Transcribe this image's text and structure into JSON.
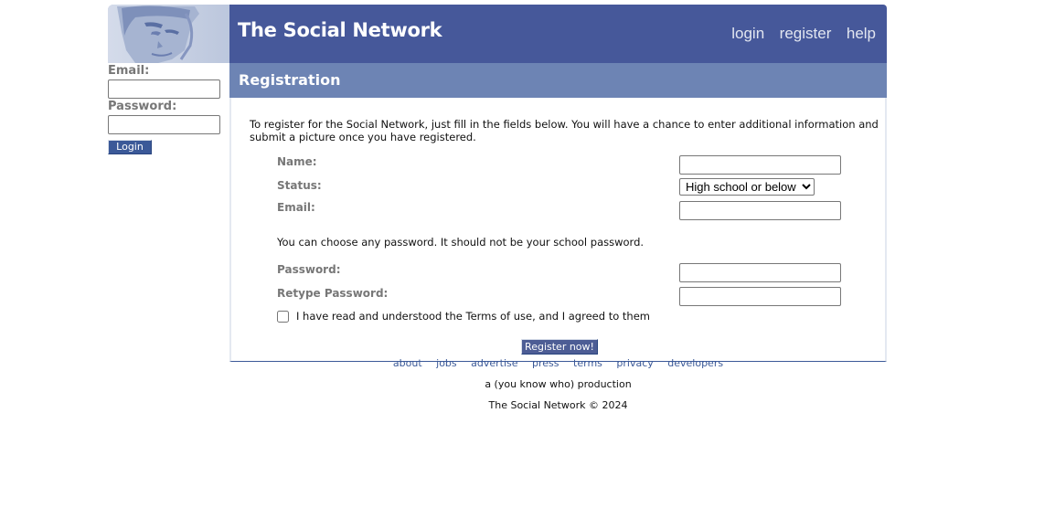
{
  "header": {
    "site_title": "The Social Network",
    "nav": [
      {
        "label": "login"
      },
      {
        "label": "register"
      },
      {
        "label": "help"
      }
    ],
    "brand_color": "#46589a"
  },
  "sidebar": {
    "email_label": "Email:",
    "email_value": "",
    "password_label": "Password:",
    "password_value": "",
    "login_button": "Login"
  },
  "registration": {
    "section_title": "Registration",
    "intro": "To register for the Social Network, just fill in the fields below. You will have a chance to enter additional information and submit a picture once you have registered.",
    "fields": {
      "name_label": "Name:",
      "name_value": "",
      "status_label": "Status:",
      "status_selected": "High school or below",
      "email_label": "Email:",
      "email_value": "",
      "password_note": "You can choose any password. It should not be your school password.",
      "password_label": "Password:",
      "password_value": "",
      "retype_password_label": "Retype Password:",
      "retype_password_value": ""
    },
    "terms_label": "I have read and understood the Terms of use, and I agreed to them",
    "terms_checked": false,
    "submit_button": "Register now!"
  },
  "footer": {
    "links": [
      {
        "label": "about"
      },
      {
        "label": "jobs"
      },
      {
        "label": "advertise"
      },
      {
        "label": "press"
      },
      {
        "label": "terms"
      },
      {
        "label": "privacy"
      },
      {
        "label": "developers"
      }
    ],
    "production": "a (you know who) production",
    "copyright": "The Social Network © 2024"
  }
}
